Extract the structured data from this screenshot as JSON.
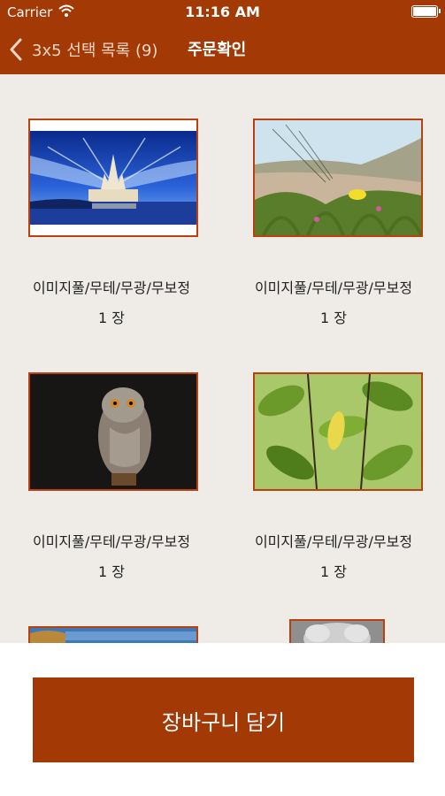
{
  "status_bar": {
    "carrier": "Carrier",
    "time": "11:16 AM"
  },
  "nav": {
    "back_label": "3x5 선택 목록 (9)",
    "title": "주문확인"
  },
  "items": [
    {
      "name": "이미지풀/무테/무광/무보정",
      "qty": "1 장",
      "photo": "castle-night"
    },
    {
      "name": "이미지풀/무테/무광/무보정",
      "qty": "1 장",
      "photo": "dune-grass-flower"
    },
    {
      "name": "이미지풀/무테/무광/무보정",
      "qty": "1 장",
      "photo": "owl"
    },
    {
      "name": "이미지풀/무테/무광/무보정",
      "qty": "1 장",
      "photo": "lemon-tree"
    },
    {
      "name": "",
      "qty": "",
      "photo": "coast-landscape"
    },
    {
      "name": "",
      "qty": "",
      "photo": "koala"
    }
  ],
  "cart_button_label": "장바구니 담기",
  "colors": {
    "brand": "#a33a06",
    "frame": "#b8410e",
    "background": "#efece7"
  }
}
